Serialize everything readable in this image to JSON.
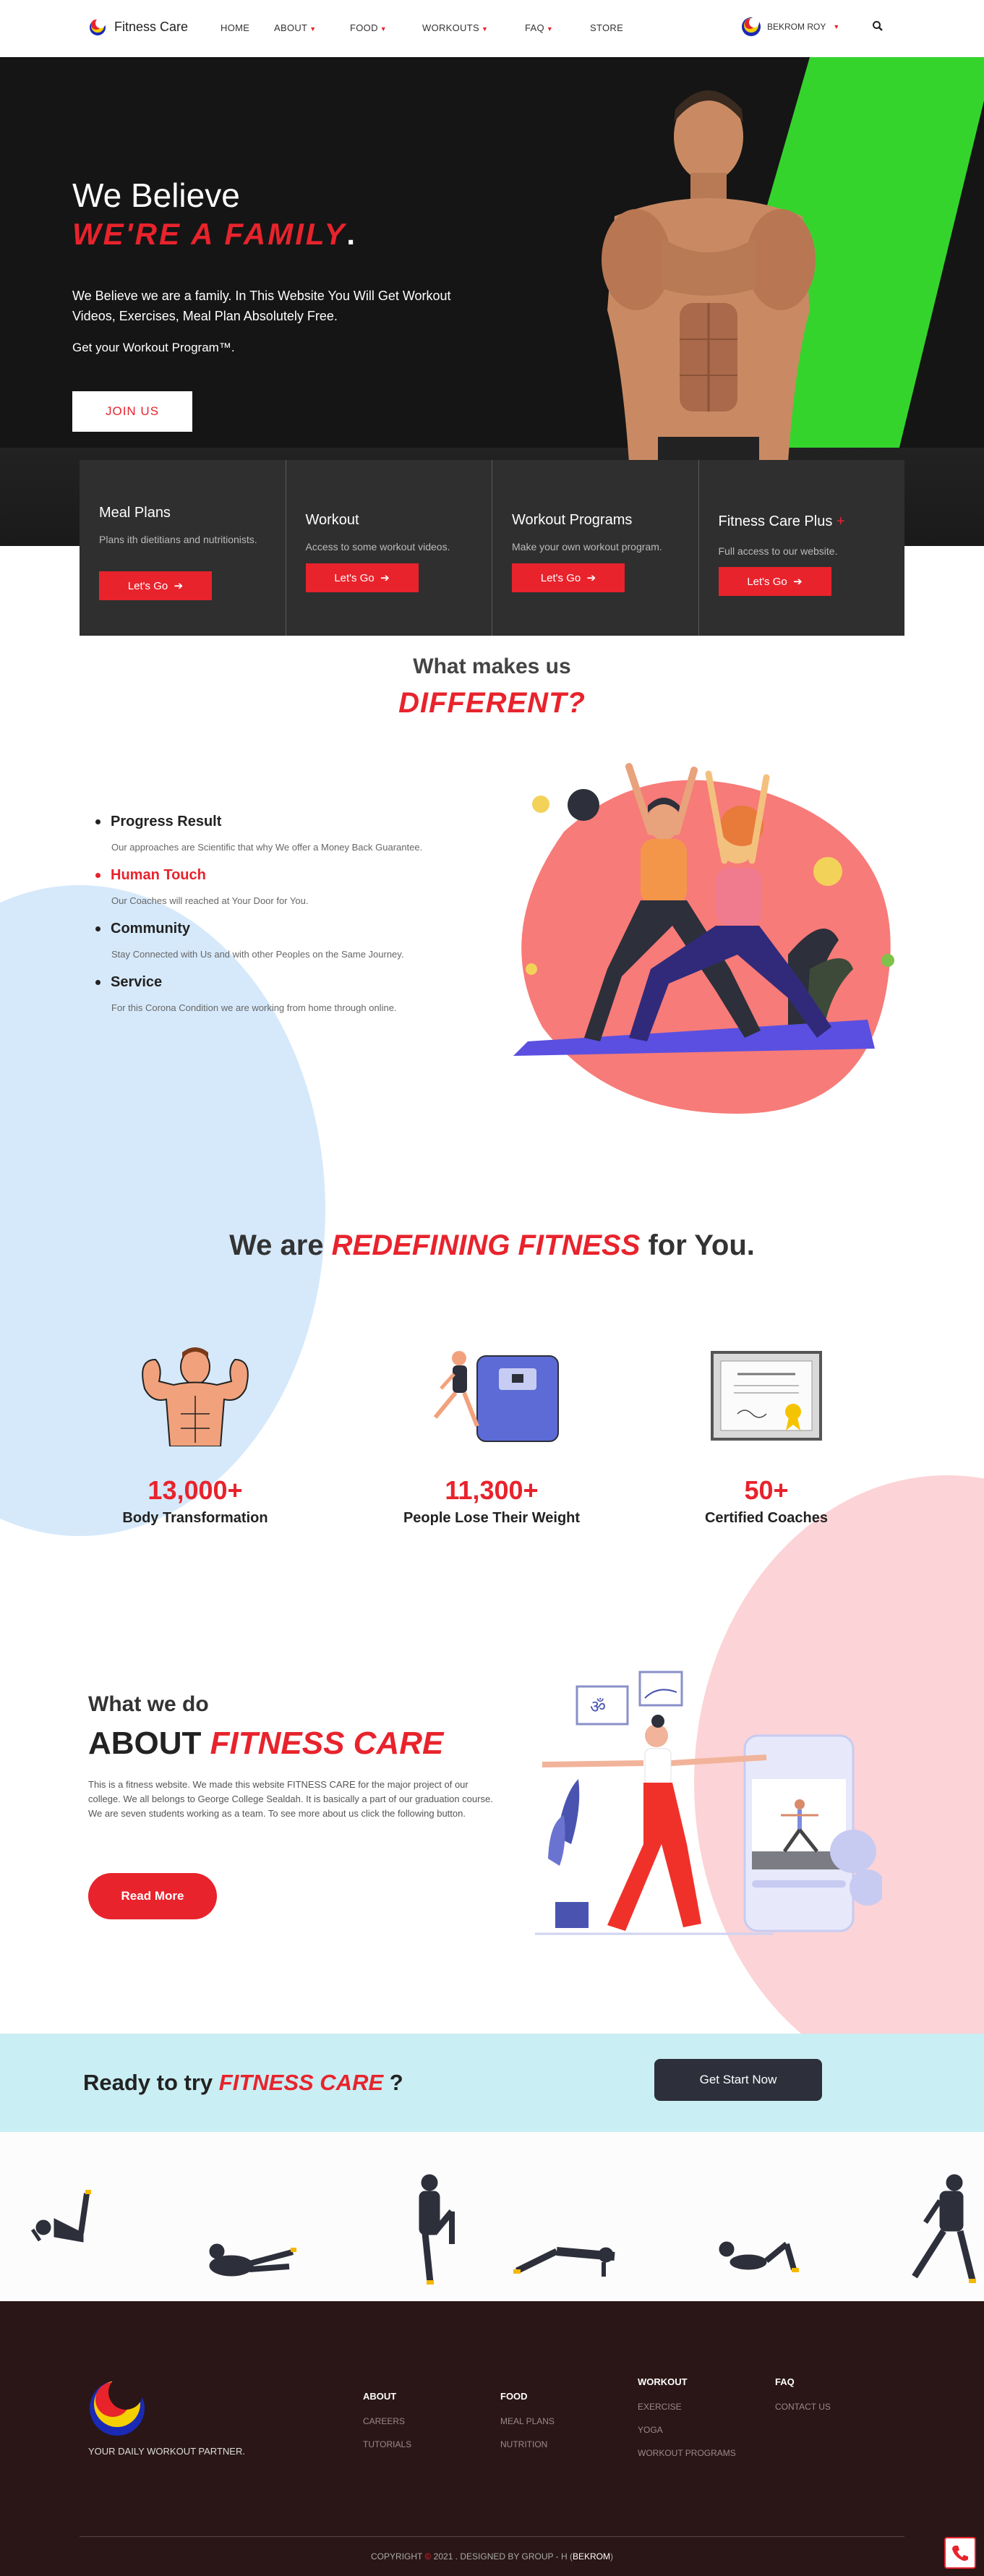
{
  "nav": {
    "brand": "Fitness Care",
    "items": [
      "HOME",
      "ABOUT",
      "FOOD",
      "WORKOUTS",
      "FAQ",
      "STORE"
    ],
    "user": "BEKROM ROY"
  },
  "hero": {
    "line1": "We Believe",
    "line2": "WE'RE  A  FAMILY",
    "line2_dot": ".",
    "paragraph": "We Believe we are a family. In This Website You Will Get Workout Videos, Exercises, Meal Plan Absolutely Free.",
    "tagline": "Get your Workout Program™.",
    "join_label": "JOIN US",
    "accent_green": "#35d42d"
  },
  "cards": [
    {
      "title": "Meal Plans",
      "desc": "Plans ith dietitians and nutritionists.",
      "btn": "Let's Go"
    },
    {
      "title": "Workout",
      "desc": "Access to some workout videos.",
      "btn": "Let's Go"
    },
    {
      "title": "Workout Programs",
      "desc": "Make your own workout program.",
      "btn": "Let's Go"
    },
    {
      "title": "Fitness Care Plus",
      "plus": "+",
      "desc": "Full access to our website.",
      "btn": "Let's Go"
    }
  ],
  "different": {
    "subtitle": "What makes us",
    "title": "DIFFERENT?",
    "features": [
      {
        "title": "Progress Result",
        "desc": "Our approaches are Scientific that why We offer a Money Back Guarantee."
      },
      {
        "title": "Human Touch",
        "desc": "Our Coaches will reached at Your Door for You."
      },
      {
        "title": "Community",
        "desc": "Stay Connected with Us and with other Peoples on the Same Journey."
      },
      {
        "title": "Service",
        "desc": "For this Corona Condition we are working from home through online."
      }
    ]
  },
  "redefining": {
    "pre": "We are ",
    "highlight": "REDEFINING FITNESS",
    "post": " for You."
  },
  "stats": [
    {
      "number": "13,000+",
      "label": "Body Transformation"
    },
    {
      "number": "11,300+",
      "label": "People Lose Their Weight"
    },
    {
      "number": "50+",
      "label": "Certified Coaches"
    }
  ],
  "about": {
    "subtitle": "What we do",
    "title_pre": "ABOUT ",
    "title_highlight": "FITNESS CARE",
    "paragraph": "This is a fitness website. We made this website FITNESS CARE for the major project of our college. We all belongs to George College Sealdah. It is basically a part of our graduation course. We are seven students working as a team. To see more about us click the following button.",
    "button": "Read More"
  },
  "cta": {
    "pre": "Ready to try ",
    "highlight": "FITNESS CARE",
    "post": " ?",
    "button": "Get Start Now"
  },
  "footer": {
    "tagline": "YOUR DAILY WORKOUT PARTNER.",
    "columns": [
      {
        "head": "ABOUT",
        "links": [
          "CAREERS",
          "TUTORIALS"
        ]
      },
      {
        "head": "FOOD",
        "links": [
          "MEAL PLANS",
          "NUTRITION"
        ]
      },
      {
        "head": "WORKOUT",
        "links": [
          "EXERCISE",
          "YOGA",
          "WORKOUT PROGRAMS"
        ]
      },
      {
        "head": "FAQ",
        "links": [
          "CONTACT US"
        ]
      }
    ],
    "copyright_pre": "COPYRIGHT",
    "copyright_symbol": "©",
    "copyright_post": "2021 . DESIGNED BY GROUP - H  (",
    "copyright_name": "BEKROM",
    "copyright_end": ")"
  },
  "colors": {
    "accent": "#e8232c",
    "dark": "#2f2f2f",
    "footer": "#2a1616",
    "cta_bg": "#c9eef3"
  }
}
